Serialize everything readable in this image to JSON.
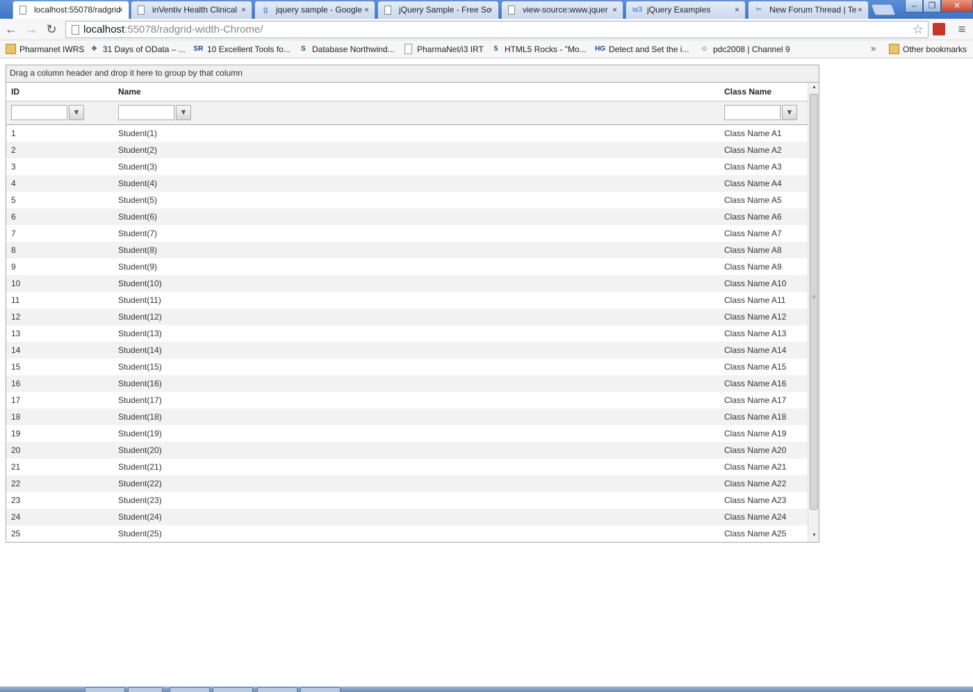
{
  "browser": {
    "tabs": [
      {
        "title": "localhost:55078/radgrid",
        "close": "×",
        "icon": "page-icon",
        "active": true
      },
      {
        "title": "inVentiv Health Clinical",
        "close": "×",
        "icon": "page-icon"
      },
      {
        "title": "jquery sample - Google",
        "close": "×",
        "icon": "google-icon",
        "icon_glyph": "g"
      },
      {
        "title": "jQuery Sample - Free Sc",
        "close": "×",
        "icon": "page-icon"
      },
      {
        "title": "view-source:www.jquer",
        "close": "×",
        "icon": "page-icon"
      },
      {
        "title": "jQuery Examples",
        "close": "×",
        "icon": "w3-icon",
        "icon_glyph": "w3"
      },
      {
        "title": "New Forum Thread | Te",
        "close": "×",
        "icon": "telerik-icon",
        "icon_glyph": "✂"
      }
    ],
    "window_buttons": {
      "minimize": "–",
      "restore": "❐",
      "close": "✕"
    },
    "nav": {
      "back": "←",
      "forward": "→",
      "reload": "↻"
    },
    "url": {
      "host": "localhost",
      "rest": ":55078/radgrid-width-Chrome/"
    },
    "star": "☆",
    "menu": "≡",
    "bookmarks": [
      {
        "label": "Pharmanet IWRS",
        "icon": "folder-icon"
      },
      {
        "label": "31 Days of OData – ...",
        "icon": "windows-icon",
        "glyph": "❖"
      },
      {
        "label": "10 Excellent Tools fo...",
        "icon": "sr-icon",
        "glyph": "SR"
      },
      {
        "label": "Database Northwind...",
        "icon": "s-icon",
        "glyph": "S"
      },
      {
        "label": "PharmaNet/i3 IRT",
        "icon": "doc-icon"
      },
      {
        "label": "HTML5 Rocks - \"Mo...",
        "icon": "html5-icon",
        "glyph": "5"
      },
      {
        "label": "Detect and Set the i...",
        "icon": "hg-icon",
        "glyph": "HG"
      },
      {
        "label": "pdc2008 | Channel 9",
        "icon": "channel9-icon",
        "glyph": "☺"
      }
    ],
    "bookmarks_more": "»",
    "other_bookmarks": "Other bookmarks"
  },
  "grid": {
    "group_panel_text": "Drag a column header and drop it here to group by that column",
    "columns": [
      "ID",
      "Name",
      "Class Name"
    ],
    "filter_icon": "▼",
    "rows": [
      [
        "1",
        "Student(1)",
        "Class Name A1"
      ],
      [
        "2",
        "Student(2)",
        "Class Name A2"
      ],
      [
        "3",
        "Student(3)",
        "Class Name A3"
      ],
      [
        "4",
        "Student(4)",
        "Class Name A4"
      ],
      [
        "5",
        "Student(5)",
        "Class Name A5"
      ],
      [
        "6",
        "Student(6)",
        "Class Name A6"
      ],
      [
        "7",
        "Student(7)",
        "Class Name A7"
      ],
      [
        "8",
        "Student(8)",
        "Class Name A8"
      ],
      [
        "9",
        "Student(9)",
        "Class Name A9"
      ],
      [
        "10",
        "Student(10)",
        "Class Name A10"
      ],
      [
        "11",
        "Student(11)",
        "Class Name A11"
      ],
      [
        "12",
        "Student(12)",
        "Class Name A12"
      ],
      [
        "13",
        "Student(13)",
        "Class Name A13"
      ],
      [
        "14",
        "Student(14)",
        "Class Name A14"
      ],
      [
        "15",
        "Student(15)",
        "Class Name A15"
      ],
      [
        "16",
        "Student(16)",
        "Class Name A16"
      ],
      [
        "17",
        "Student(17)",
        "Class Name A17"
      ],
      [
        "18",
        "Student(18)",
        "Class Name A18"
      ],
      [
        "19",
        "Student(19)",
        "Class Name A19"
      ],
      [
        "20",
        "Student(20)",
        "Class Name A20"
      ],
      [
        "21",
        "Student(21)",
        "Class Name A21"
      ],
      [
        "22",
        "Student(22)",
        "Class Name A22"
      ],
      [
        "23",
        "Student(23)",
        "Class Name A23"
      ],
      [
        "24",
        "Student(24)",
        "Class Name A24"
      ],
      [
        "25",
        "Student(25)",
        "Class Name A25"
      ]
    ],
    "scroll_up": "▲",
    "scroll_down": "▼",
    "scroll_grip": "≡"
  }
}
